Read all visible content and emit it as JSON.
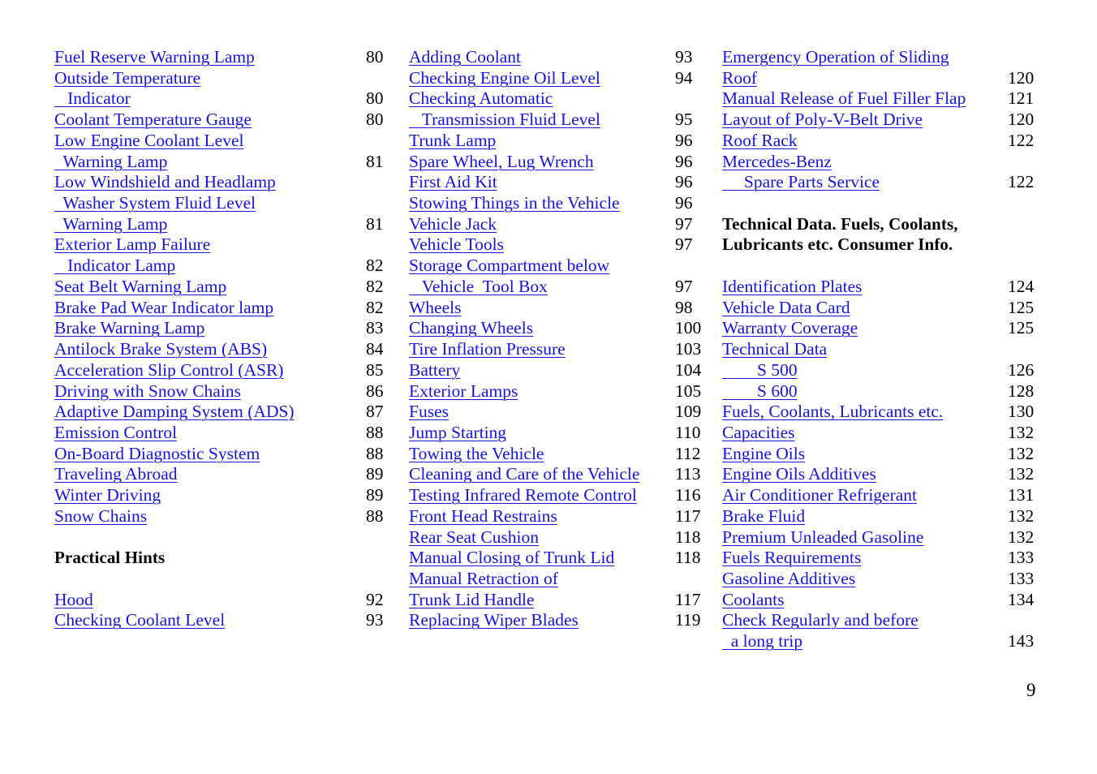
{
  "document": {
    "page_number": "9",
    "link_color": "#1414E0",
    "text_color": "#000000",
    "background_color": "#FFFFFF"
  },
  "columns": [
    {
      "id": "column-1",
      "blocks": [
        {
          "type": "entries",
          "items": [
            {
              "label": "Fuel Reserve Warning Lamp",
              "page": "80",
              "indent": 0
            },
            {
              "label": "Outside Temperature",
              "page": "",
              "indent": 0
            },
            {
              "label": "   Indicator",
              "page": "80",
              "indent": 0
            },
            {
              "label": "Coolant Temperature Gauge",
              "page": "80",
              "indent": 0
            },
            {
              "label": "Low Engine Coolant Level",
              "page": "",
              "indent": 0
            },
            {
              "label": "  Warning Lamp",
              "page": "81",
              "indent": 0
            },
            {
              "label": "Low Windshield and Headlamp",
              "page": "",
              "indent": 0
            },
            {
              "label": "  Washer System Fluid Level",
              "page": "",
              "indent": 0
            },
            {
              "label": "  Warning Lamp",
              "page": "81",
              "indent": 0
            },
            {
              "label": "Exterior Lamp Failure",
              "page": "",
              "indent": 0
            },
            {
              "label": "   Indicator Lamp",
              "page": "82",
              "indent": 0
            },
            {
              "label": "Seat Belt Warning Lamp",
              "page": "82",
              "indent": 0
            },
            {
              "label": "Brake Pad Wear Indicator lamp",
              "page": "82",
              "indent": 0
            },
            {
              "label": "Brake Warning Lamp",
              "page": "83",
              "indent": 0
            },
            {
              "label": "Antilock Brake System (ABS)",
              "page": "84",
              "indent": 0
            },
            {
              "label": "Acceleration Slip Control (ASR)",
              "page": "85",
              "indent": 0
            },
            {
              "label": "Driving with Snow Chains",
              "page": "86",
              "indent": 0
            },
            {
              "label": "Adaptive Damping System (ADS)",
              "page": "87",
              "indent": 0
            },
            {
              "label": "Emission Control",
              "page": "88",
              "indent": 0
            },
            {
              "label": "On-Board Diagnostic System",
              "page": "88",
              "indent": 0
            },
            {
              "label": "Traveling Abroad",
              "page": "89",
              "indent": 0
            },
            {
              "label": "Winter Driving",
              "page": "89",
              "indent": 0
            },
            {
              "label": "Snow Chains",
              "page": "88",
              "indent": 0
            }
          ]
        },
        {
          "type": "spacer"
        },
        {
          "type": "heading",
          "label": "Practical Hints"
        },
        {
          "type": "spacer"
        },
        {
          "type": "entries",
          "items": [
            {
              "label": "Hood",
              "page": "92",
              "indent": 0
            },
            {
              "label": "Checking Coolant Level",
              "page": "93",
              "indent": 0
            }
          ]
        }
      ]
    },
    {
      "id": "column-2",
      "blocks": [
        {
          "type": "entries",
          "items": [
            {
              "label": "Adding Coolant",
              "page": "93",
              "indent": 0
            },
            {
              "label": "Checking Engine Oil Level",
              "page": "94",
              "indent": 0
            },
            {
              "label": "Checking Automatic",
              "page": "",
              "indent": 0
            },
            {
              "label": "   Transmission Fluid Level",
              "page": "95",
              "indent": 0
            },
            {
              "label": "Trunk Lamp",
              "page": "96",
              "indent": 0
            },
            {
              "label": "Spare Wheel, Lug Wrench",
              "page": "96",
              "indent": 0
            },
            {
              "label": "First Aid Kit",
              "page": "96",
              "indent": 0
            },
            {
              "label": "Stowing Things in the Vehicle",
              "page": "96",
              "indent": 0
            },
            {
              "label": "Vehicle Jack",
              "page": "97",
              "indent": 0
            },
            {
              "label": "Vehicle Tools",
              "page": "97",
              "indent": 0
            },
            {
              "label": "Storage Compartment below",
              "page": "",
              "indent": 0
            },
            {
              "label": "   Vehicle  Tool Box",
              "page": "97",
              "indent": 0
            },
            {
              "label": "Wheels",
              "page": "98",
              "indent": 0
            },
            {
              "label": "Changing Wheels",
              "page": "100",
              "indent": 0
            },
            {
              "label": "Tire Inflation Pressure",
              "page": "103",
              "indent": 0
            },
            {
              "label": "Battery",
              "page": "104",
              "indent": 0
            },
            {
              "label": "Exterior Lamps",
              "page": "105",
              "indent": 0
            },
            {
              "label": "Fuses",
              "page": "109",
              "indent": 0
            },
            {
              "label": "Jump Starting",
              "page": "110",
              "indent": 0
            },
            {
              "label": "Towing the Vehicle",
              "page": "112",
              "indent": 0
            },
            {
              "label": "Cleaning and Care of the Vehicle",
              "page": "113",
              "indent": 0
            },
            {
              "label": "Testing Infrared Remote Control",
              "page": "116",
              "indent": 0
            },
            {
              "label": "Front Head Restrains",
              "page": "117",
              "indent": 0
            },
            {
              "label": "Rear Seat Cushion",
              "page": "118",
              "indent": 0
            },
            {
              "label": "Manual Closing of Trunk Lid",
              "page": "118",
              "indent": 0
            },
            {
              "label": "Manual Retraction of",
              "page": "",
              "indent": 0
            },
            {
              "label": "Trunk Lid Handle",
              "page": "117",
              "indent": 0
            },
            {
              "label": "Replacing Wiper Blades",
              "page": "119",
              "indent": 0
            }
          ]
        }
      ]
    },
    {
      "id": "column-3",
      "blocks": [
        {
          "type": "entries",
          "items": [
            {
              "label": "Emergency Operation of Sliding",
              "page": "",
              "indent": 0
            },
            {
              "label": "Roof",
              "page": "120",
              "indent": 0
            },
            {
              "label": "Manual Release of Fuel Filler Flap",
              "page": "121",
              "indent": 0
            },
            {
              "label": "Layout of Poly-V-Belt Drive",
              "page": "120",
              "indent": 0
            },
            {
              "label": "Roof Rack",
              "page": "122",
              "indent": 0
            },
            {
              "label": "Mercedes-Benz",
              "page": "",
              "indent": 0
            },
            {
              "label": "     Spare Parts Service",
              "page": "122",
              "indent": 0
            }
          ]
        },
        {
          "type": "spacer"
        },
        {
          "type": "heading",
          "label": "Technical Data. Fuels, Coolants,"
        },
        {
          "type": "heading",
          "label": "Lubricants etc. Consumer Info."
        },
        {
          "type": "spacer"
        },
        {
          "type": "entries",
          "items": [
            {
              "label": "Identification Plates",
              "page": "124",
              "indent": 0
            },
            {
              "label": "Vehicle Data Card",
              "page": "125",
              "indent": 0
            },
            {
              "label": "Warranty Coverage",
              "page": "125",
              "indent": 0
            },
            {
              "label": "Technical Data",
              "page": "",
              "indent": 0
            },
            {
              "label": "        S 500",
              "page": "126",
              "indent": 0
            },
            {
              "label": "        S 600",
              "page": "128",
              "indent": 0
            },
            {
              "label": "Fuels, Coolants, Lubricants etc.",
              "page": "130",
              "indent": 0
            },
            {
              "label": "Capacities",
              "page": "132",
              "indent": 0
            },
            {
              "label": "Engine Oils",
              "page": "132",
              "indent": 0
            },
            {
              "label": "Engine Oils Additives",
              "page": "132",
              "indent": 0
            },
            {
              "label": "Air Conditioner Refrigerant",
              "page": "131",
              "indent": 0
            },
            {
              "label": "Brake Fluid",
              "page": "132",
              "indent": 0
            },
            {
              "label": "Premium Unleaded Gasoline",
              "page": "132",
              "indent": 0
            },
            {
              "label": "Fuels Requirements",
              "page": "133",
              "indent": 0
            },
            {
              "label": "Gasoline Additives",
              "page": "133",
              "indent": 0
            },
            {
              "label": "Coolants",
              "page": "134",
              "indent": 0
            },
            {
              "label": "Check Regularly and before",
              "page": "",
              "indent": 0
            },
            {
              "label": "  a long trip",
              "page": "143",
              "indent": 0
            }
          ]
        }
      ]
    }
  ]
}
